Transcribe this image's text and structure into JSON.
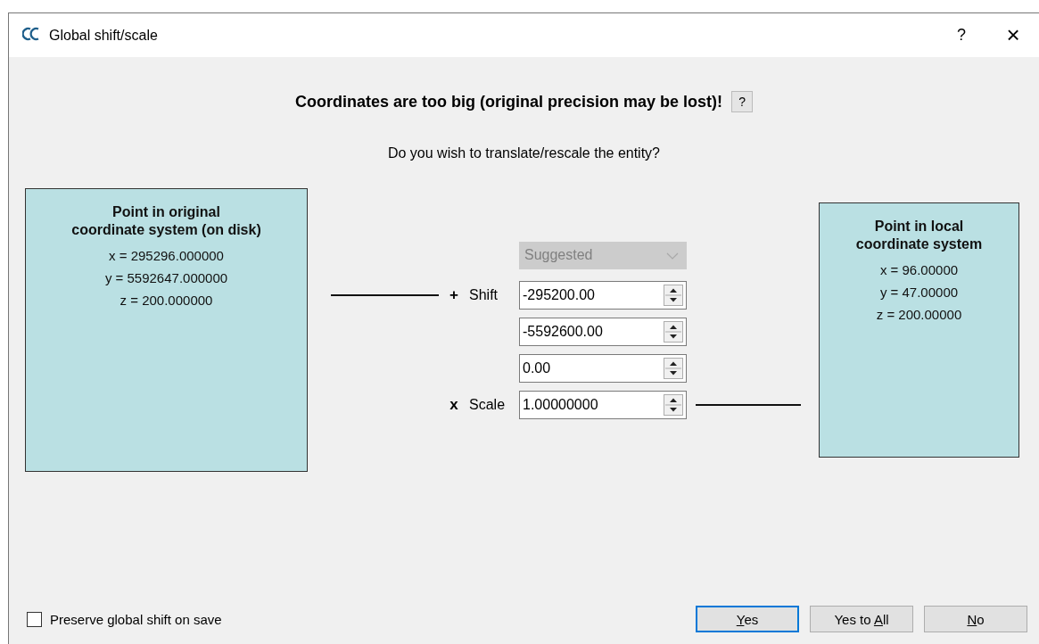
{
  "window": {
    "title": "Global shift/scale",
    "help": "?",
    "close": "×"
  },
  "message": {
    "heading": "Coordinates are too big (original precision may be lost)!",
    "help_button": "?",
    "question": "Do you wish to translate/rescale the entity?"
  },
  "original_point": {
    "title": "Point in original\ncoordinate system (on disk)",
    "coords": [
      "x = 295296.000000",
      "y = 5592647.000000",
      "z = 200.000000"
    ]
  },
  "transform": {
    "mode": {
      "value": "Suggested",
      "disabled": true
    },
    "shift": {
      "sign": "+",
      "label": "Shift",
      "values": [
        "-295200.00",
        "-5592600.00",
        "0.00"
      ]
    },
    "scale": {
      "sign": "x",
      "label": "Scale",
      "value": "1.00000000"
    }
  },
  "local_point": {
    "title": "Point in local\ncoordinate system",
    "coords": [
      "x = 96.00000",
      "y = 47.00000",
      "z = 200.00000"
    ]
  },
  "footer": {
    "checkbox": {
      "label": "Preserve global shift on save",
      "checked": false
    },
    "buttons": [
      {
        "label": [
          {
            "text": "Y",
            "underlined": true
          },
          {
            "text": "es",
            "underlined": false
          }
        ],
        "default": true
      },
      {
        "label": [
          {
            "text": "Yes to ",
            "underlined": false
          },
          {
            "text": "A",
            "underlined": true
          },
          {
            "text": "ll",
            "underlined": false
          }
        ],
        "default": false
      },
      {
        "label": [
          {
            "text": "N",
            "underlined": true
          },
          {
            "text": "o",
            "underlined": false
          }
        ],
        "default": false
      }
    ]
  }
}
